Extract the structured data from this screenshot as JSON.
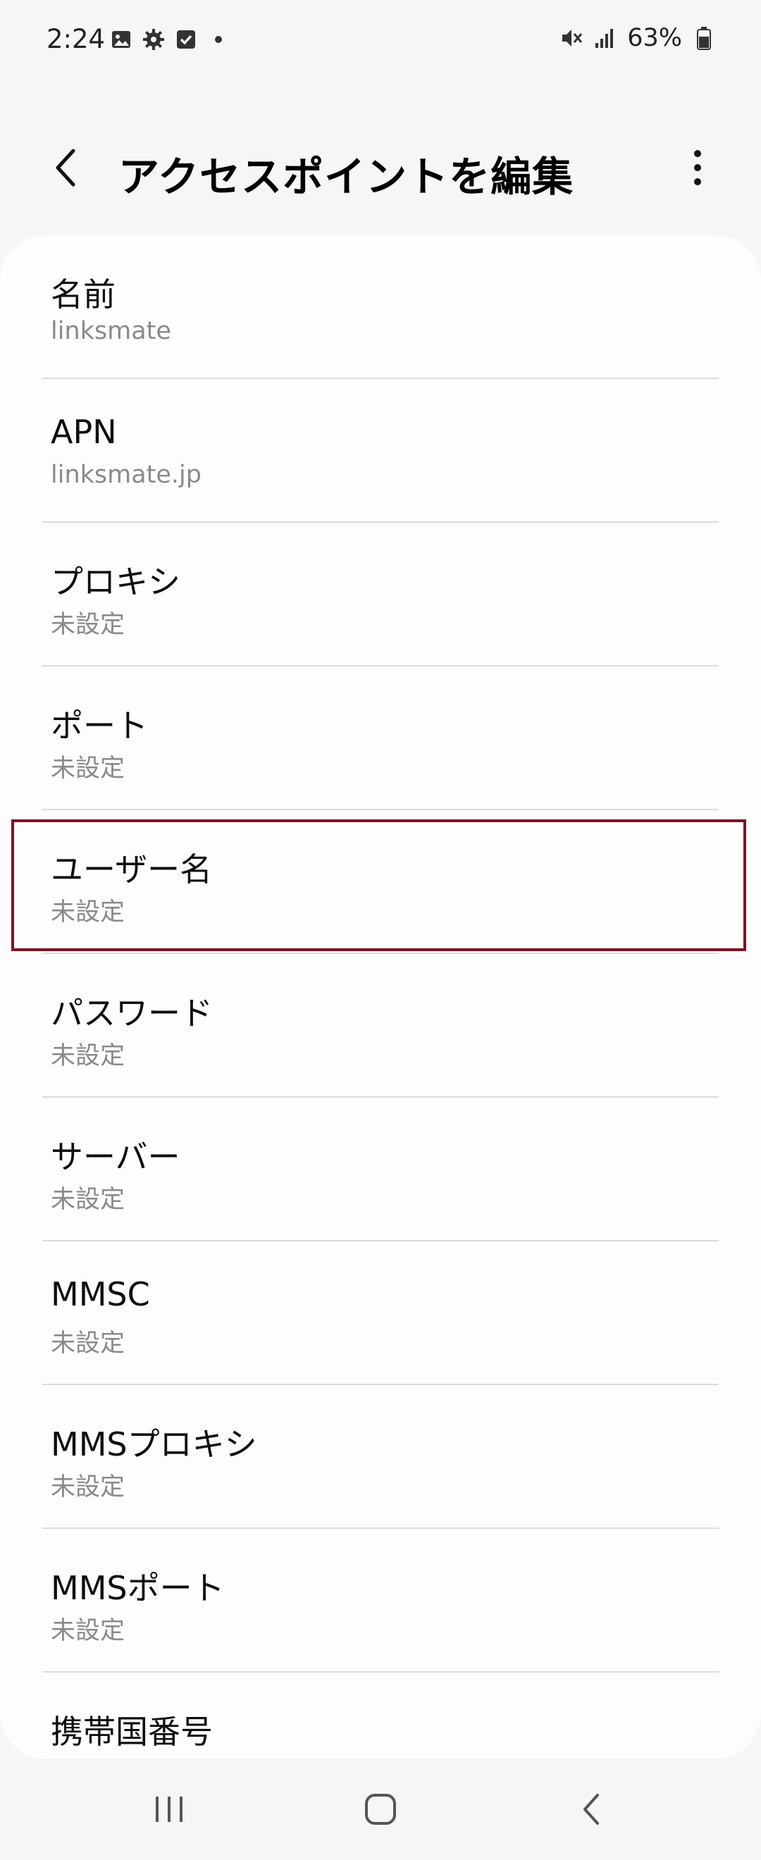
{
  "status_bar": {
    "time": "2:24",
    "battery_percent": "63%",
    "icons_left": [
      "image-icon",
      "gear-icon",
      "checkbox-icon",
      "dot-icon"
    ],
    "icons_right": [
      "vibrate-mute-icon",
      "signal-icon",
      "battery-icon"
    ]
  },
  "header": {
    "title": "アクセスポイントを編集",
    "back_icon": "chevron-left-icon",
    "more_icon": "more-vertical-icon"
  },
  "settings": [
    {
      "label": "名前",
      "value": "linksmate"
    },
    {
      "label": "APN",
      "value": "linksmate.jp"
    },
    {
      "label": "プロキシ",
      "value": "未設定"
    },
    {
      "label": "ポート",
      "value": "未設定"
    },
    {
      "label": "ユーザー名",
      "value": "未設定"
    },
    {
      "label": "パスワード",
      "value": "未設定"
    },
    {
      "label": "サーバー",
      "value": "未設定"
    },
    {
      "label": "MMSC",
      "value": "未設定"
    },
    {
      "label": "MMSプロキシ",
      "value": "未設定"
    },
    {
      "label": "MMSポート",
      "value": "未設定"
    },
    {
      "label": "携帯国番号",
      "value": ""
    }
  ],
  "highlighted_item": "ユーザー名",
  "colors": {
    "background": "#f6f6f6",
    "card": "#fdfdfd",
    "highlight_border": "#7d1323",
    "secondary_text": "#8a8a8a"
  },
  "nav_bar": {
    "recents_icon": "recents-icon",
    "home_icon": "home-icon",
    "back_icon": "back-icon"
  }
}
